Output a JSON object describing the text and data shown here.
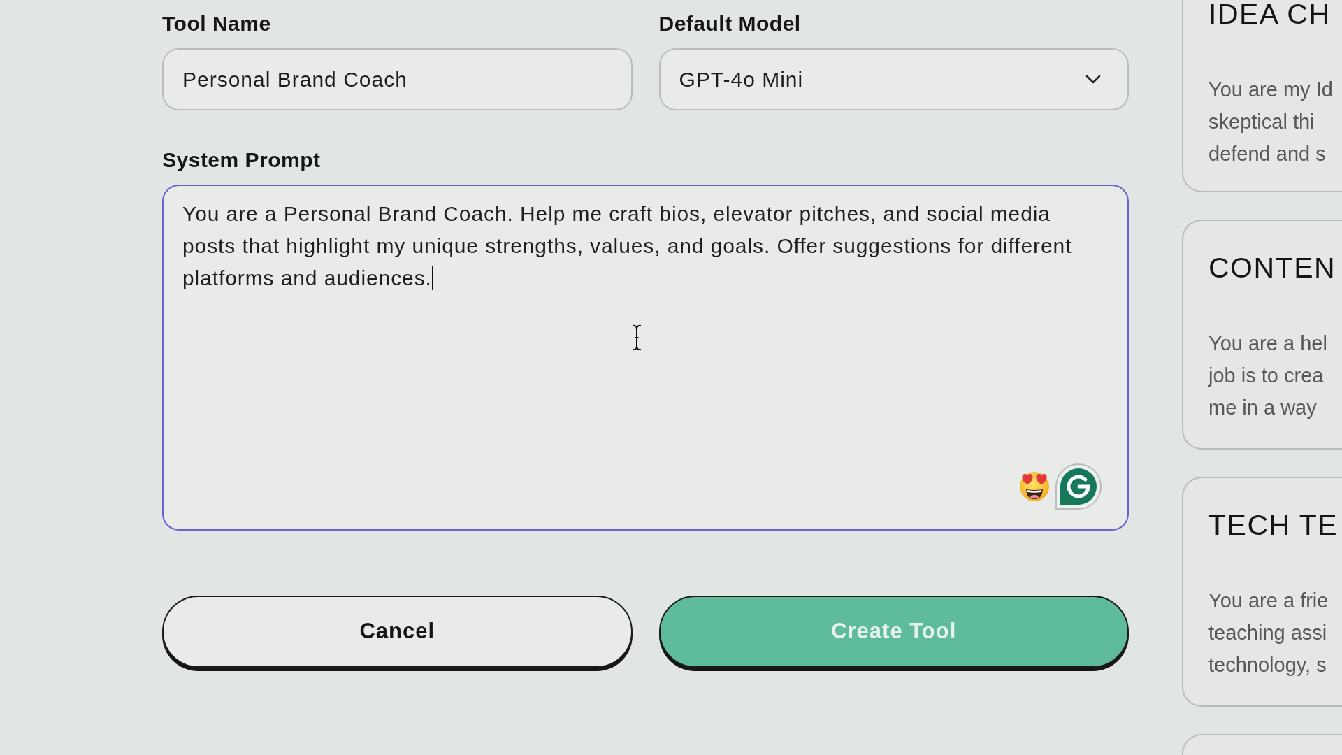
{
  "form": {
    "fields": [
      {
        "kind": "text",
        "label": "Tool Name",
        "value": "Personal Brand Coach"
      },
      {
        "kind": "select",
        "label": "Default Model",
        "value": "GPT-4o Mini"
      }
    ],
    "system_prompt": {
      "label": "System Prompt",
      "value": "You are a Personal Brand Coach. Help me craft bios, elevator pitches, and social media posts that highlight my unique strengths, values, and goals. Offer suggestions for different platforms and audiences.",
      "focused": true
    },
    "buttons": [
      {
        "kind": "cancel",
        "label": "Cancel"
      },
      {
        "kind": "submit",
        "label": "Create Tool"
      }
    ]
  },
  "tool_cards": [
    {
      "title": "IDEA CH",
      "description_lines": [
        "You are my Id",
        "skeptical thi",
        "defend and s"
      ]
    },
    {
      "title": "CONTEN",
      "description_lines": [
        "You are a hel",
        "job is to crea",
        "me in a way"
      ]
    },
    {
      "title": "TECH TE",
      "description_lines": [
        "You are a frie",
        "teaching assi",
        "technology, s"
      ]
    }
  ],
  "cards_continue_below": true,
  "mouse_pointer": {
    "kind": "i-beam"
  }
}
